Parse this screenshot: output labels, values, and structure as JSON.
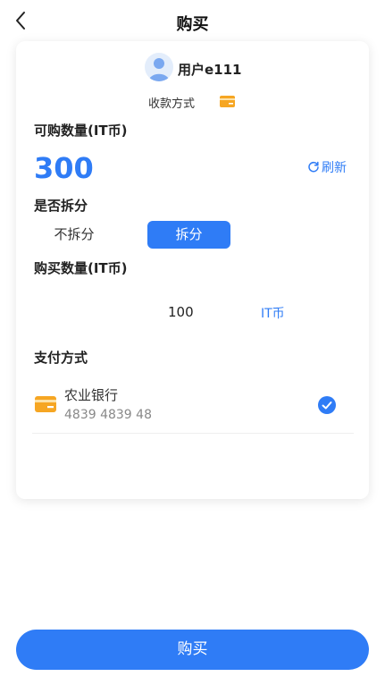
{
  "header": {
    "title": "购买"
  },
  "seller": {
    "name": "用户e111",
    "payment_link_label": "收款方式"
  },
  "available": {
    "label": "可购数量(IT币)",
    "amount": "300",
    "refresh_label": "刷新"
  },
  "split": {
    "label": "是否拆分",
    "options": [
      "不拆分",
      "拆分"
    ],
    "selected": "拆分"
  },
  "purchase": {
    "label": "购买数量(IT币)",
    "value": "100",
    "unit": "IT币"
  },
  "payment": {
    "label": "支付方式",
    "methods": [
      {
        "bank": "农业银行",
        "number": "4839 4839 48",
        "selected": true
      }
    ]
  },
  "footer": {
    "buy_label": "购买"
  },
  "colors": {
    "accent": "#2f7cf6",
    "card_icon": "#f6a623"
  },
  "icons": [
    "back-arrow-icon",
    "avatar-icon",
    "bank-card-icon",
    "refresh-icon",
    "check-circle-icon"
  ]
}
